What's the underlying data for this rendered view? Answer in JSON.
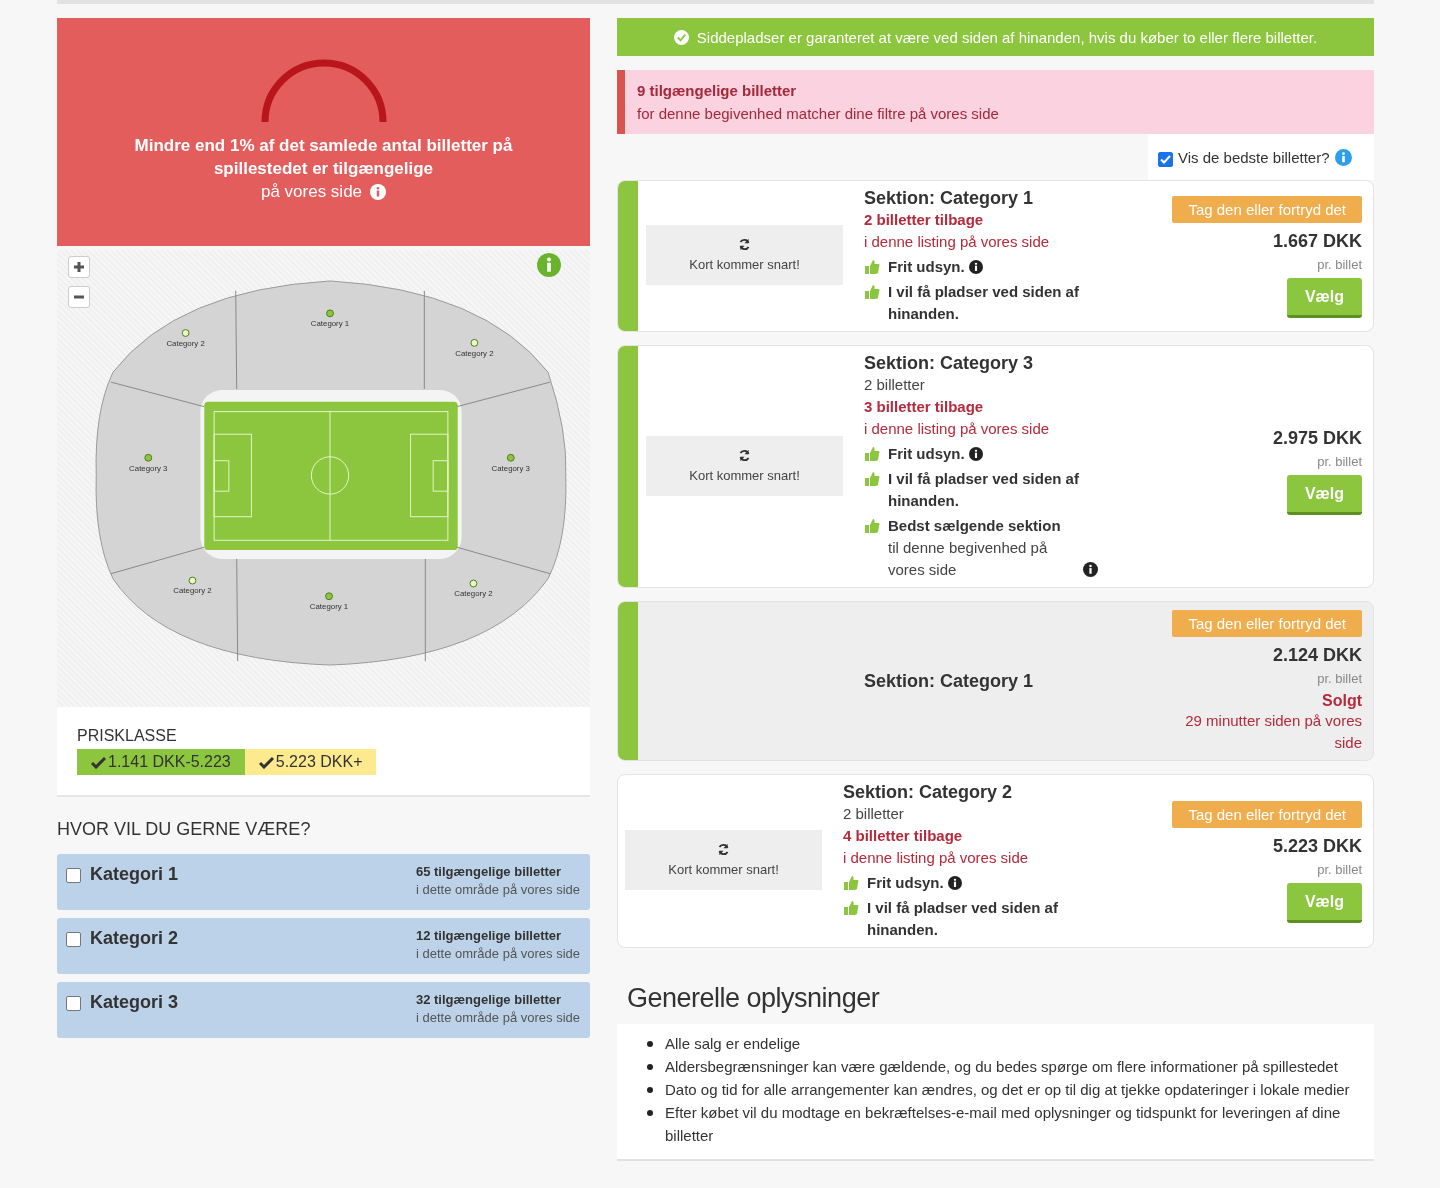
{
  "availability": {
    "headline": "Mindre end 1% af det samlede antal billetter på spillestedet er tilgængelige",
    "subline": "på vores side"
  },
  "map": {
    "sections": [
      {
        "label": "Category 1"
      },
      {
        "label": "Category 2"
      },
      {
        "label": "Category 2"
      },
      {
        "label": "Category 3"
      },
      {
        "label": "Category 3"
      },
      {
        "label": "Category 2"
      },
      {
        "label": "Category 1"
      },
      {
        "label": "Category 2"
      }
    ]
  },
  "price_filter": {
    "title": "PRISKLASSE",
    "classes": [
      {
        "label": "1.141 DKK-5.223",
        "color": "#8cc63f",
        "checked": true
      },
      {
        "label": "5.223 DKK+",
        "color": "#fde98e",
        "checked": true
      }
    ]
  },
  "areas": {
    "title": "HVOR VIL DU GERNE VÆRE?",
    "items": [
      {
        "label": "Kategori 1",
        "count": "65 tilgængelige billetter",
        "note": "i dette område på vores side",
        "checked": false
      },
      {
        "label": "Kategori 2",
        "count": "12 tilgængelige billetter",
        "note": "i dette område på vores side",
        "checked": false
      },
      {
        "label": "Kategori 3",
        "count": "32 tilgængelige billetter",
        "note": "i dette område på vores side",
        "checked": false
      }
    ]
  },
  "notice": "Siddepladser er garanteret at være ved siden af hinanden, hvis du køber to eller flere billetter.",
  "match": {
    "count": "9 tilgængelige billetter",
    "text": "for denne begivenhed matcher dine filtre på vores side"
  },
  "best_toggle": {
    "label": "Vis de bedste billetter?",
    "checked": true
  },
  "listings": [
    {
      "kind": "available",
      "accent": true,
      "map_text": "Kort kommer snart!",
      "section": "Sektion: Category 1",
      "remaining": "2 billetter tilbage",
      "remaining_note": "i denne listing på vores side",
      "features": [
        {
          "text": "Frit udsyn.",
          "info": true
        },
        {
          "text": "I vil få pladser ved siden af hinanden.",
          "info": false
        }
      ],
      "tag": "Tag den eller fortryd det",
      "price": "1.667 DKK",
      "per": "pr. billet",
      "button": "Vælg"
    },
    {
      "kind": "available",
      "accent": true,
      "map_text": "Kort kommer snart!",
      "section": "Sektion: Category 3",
      "quantity": "2 billetter",
      "remaining": "3 billetter tilbage",
      "remaining_note": "i denne listing på vores side",
      "features": [
        {
          "text": "Frit udsyn.",
          "info": true
        },
        {
          "text": "I vil få pladser ved siden af hinanden.",
          "info": false
        },
        {
          "text": "Bedst sælgende sektion",
          "note": "til denne begivenhed på vores side",
          "info": true
        }
      ],
      "price": "2.975 DKK",
      "per": "pr. billet",
      "button": "Vælg"
    },
    {
      "kind": "sold",
      "accent": true,
      "section": "Sektion: Category 1",
      "tag": "Tag den eller fortryd det",
      "price": "2.124 DKK",
      "per": "pr. billet",
      "sold": "Solgt",
      "sold_note": "29 minutter siden på vores side"
    },
    {
      "kind": "available",
      "accent": false,
      "map_text": "Kort kommer snart!",
      "section": "Sektion: Category 2",
      "quantity": "2 billetter",
      "remaining": "4 billetter tilbage",
      "remaining_note": "i denne listing på vores side",
      "features": [
        {
          "text": "Frit udsyn.",
          "info": true
        },
        {
          "text": "I vil få pladser ved siden af hinanden.",
          "info": false
        }
      ],
      "tag": "Tag den eller fortryd det",
      "price": "5.223 DKK",
      "per": "pr. billet",
      "button": "Vælg"
    }
  ],
  "info": {
    "title": "Generelle oplysninger",
    "items": [
      "Alle salg er endelige",
      "Aldersbegrænsninger kan være gældende, og du bedes spørge om flere informationer på spillestedet",
      "Dato og tid for alle arrangementer kan ændres, og det er op til dig at tjekke opdateringer i lokale medier",
      "Efter købet vil du modtage en bekræftelses-e-mail med oplysninger og tidspunkt for leveringen af dine billetter"
    ]
  }
}
